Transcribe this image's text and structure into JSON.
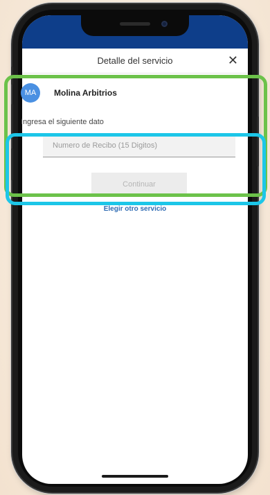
{
  "header": {
    "title": "Detalle del servicio",
    "close_label": "✕"
  },
  "service": {
    "avatar_initials": "MA",
    "name": "Molina Arbitrios",
    "avatar_color": "#4a90e2"
  },
  "form": {
    "prompt": "Ingresa el siguiente dato",
    "input_placeholder": "Numero de Recibo (15 Digitos)",
    "input_value": "",
    "continue_label": "Continuar",
    "continue_enabled": false
  },
  "links": {
    "other_service": "Elegir otro servicio"
  },
  "colors": {
    "status_bar": "#0e3e8a",
    "highlight_outer": "#6cc24a",
    "highlight_inner": "#1cc6e8",
    "link": "#2e6bb3"
  }
}
